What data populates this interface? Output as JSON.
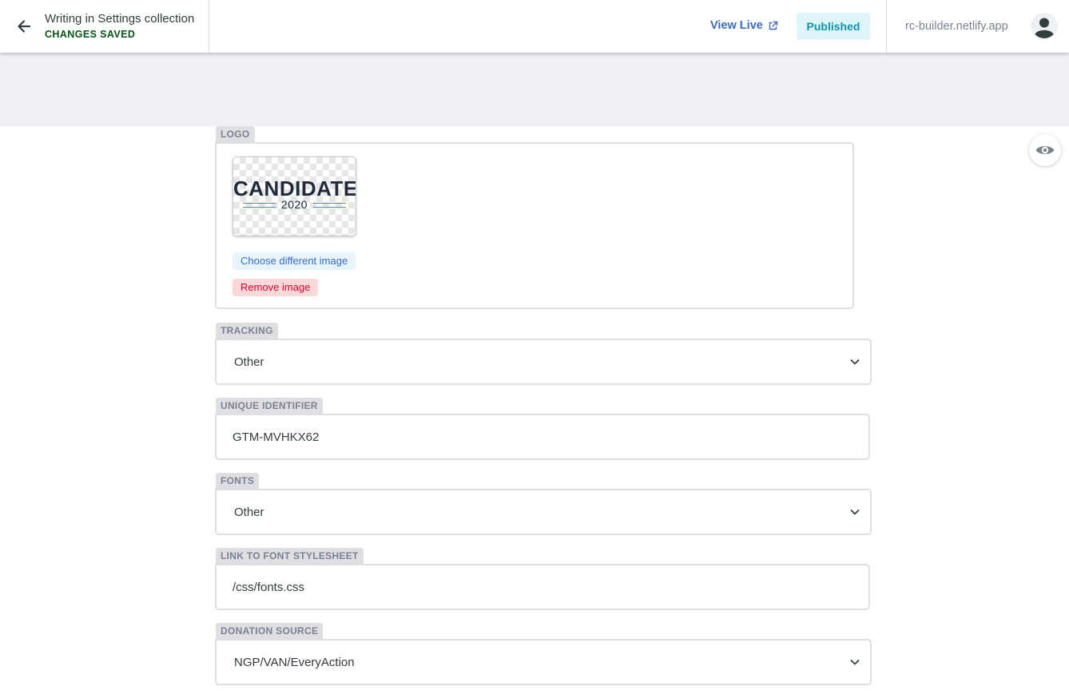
{
  "header": {
    "title": "Writing in Settings collection",
    "status": "CHANGES SAVED",
    "view_live": "View Live",
    "publish_status": "Published",
    "site": "rc-builder.netlify.app"
  },
  "fields": {
    "logo": {
      "label": "LOGO",
      "logo_text": "CANDIDATE",
      "logo_year": "2020",
      "choose_label": "Choose different image",
      "remove_label": "Remove image"
    },
    "tracking": {
      "label": "TRACKING",
      "value": "Other"
    },
    "unique_identifier": {
      "label": "UNIQUE IDENTIFIER",
      "value": "GTM-MVHKX62"
    },
    "fonts": {
      "label": "FONTS",
      "value": "Other"
    },
    "font_stylesheet": {
      "label": "LINK TO FONT STYLESHEET",
      "value": "/css/fonts.css"
    },
    "donation_source": {
      "label": "DONATION SOURCE",
      "value": "NGP/VAN/EveryAction"
    }
  },
  "icons": [
    "arrow-left-icon",
    "external-link-icon",
    "user-icon",
    "eye-icon",
    "chevron-down-icon"
  ],
  "colors": {
    "saved_green": "#005614",
    "link_blue": "#3a69c7",
    "published_teal": "#1195aa",
    "remove_red": "#d60032"
  }
}
